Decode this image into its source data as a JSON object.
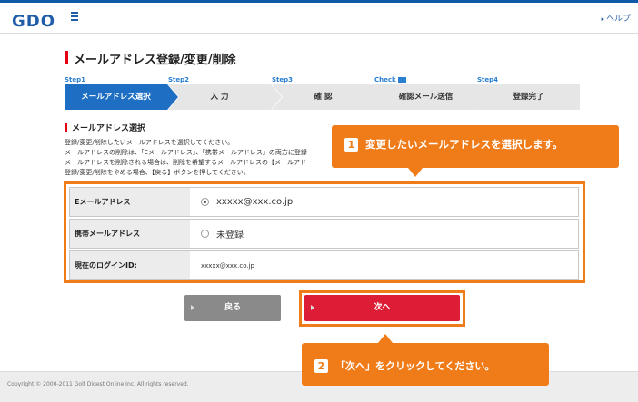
{
  "header": {
    "logo": "GDO",
    "help_label": "ヘルプ"
  },
  "page_title": "メールアドレス登録/変更/削除",
  "steps": [
    {
      "label": "Step1",
      "name": "メールアドレス選択",
      "active": true
    },
    {
      "label": "Step2",
      "name": "入 力",
      "active": false
    },
    {
      "label": "Step3",
      "name": "確 認",
      "active": false
    },
    {
      "label": "Check",
      "name": "確認メール送信",
      "active": false
    },
    {
      "label": "Step4",
      "name": "登録完了",
      "active": false
    }
  ],
  "section_title": "メールアドレス選択",
  "description": [
    "登録/変更/削除したいメールアドレスを選択してください。",
    "メールアドレスの削除は、「Eメールアドレス」、「携帯メールアドレス」の両方に登録",
    "メールアドレスを削除される場合は、削除を希望するメールアドレスの【メールアド",
    "登録/変更/削除をやめる場合、【戻る】ボタンを押してください。"
  ],
  "form": {
    "rows": [
      {
        "label": "Eメールアドレス",
        "value": "xxxxx@xxx.co.jp"
      },
      {
        "label": "携帯メールアドレス",
        "value": "未登録"
      },
      {
        "label": "現在のログインID:",
        "value": "xxxxx@xxx.co.jp"
      }
    ]
  },
  "buttons": {
    "back": "戻る",
    "next": "次へ"
  },
  "callouts": {
    "one": {
      "num": "1",
      "text": "変更したいメールアドレスを選択します。"
    },
    "two": {
      "num": "2",
      "text": "「次へ」をクリックしてください。"
    }
  },
  "footer": {
    "copyright": "Copyright © 2000-2011 Golf Digest Online Inc. All rights reserved."
  },
  "colors": {
    "accent": "#f07b19",
    "brand": "#1f5da8",
    "step_active": "#1e6ec3",
    "next_button": "#dd1d35"
  }
}
